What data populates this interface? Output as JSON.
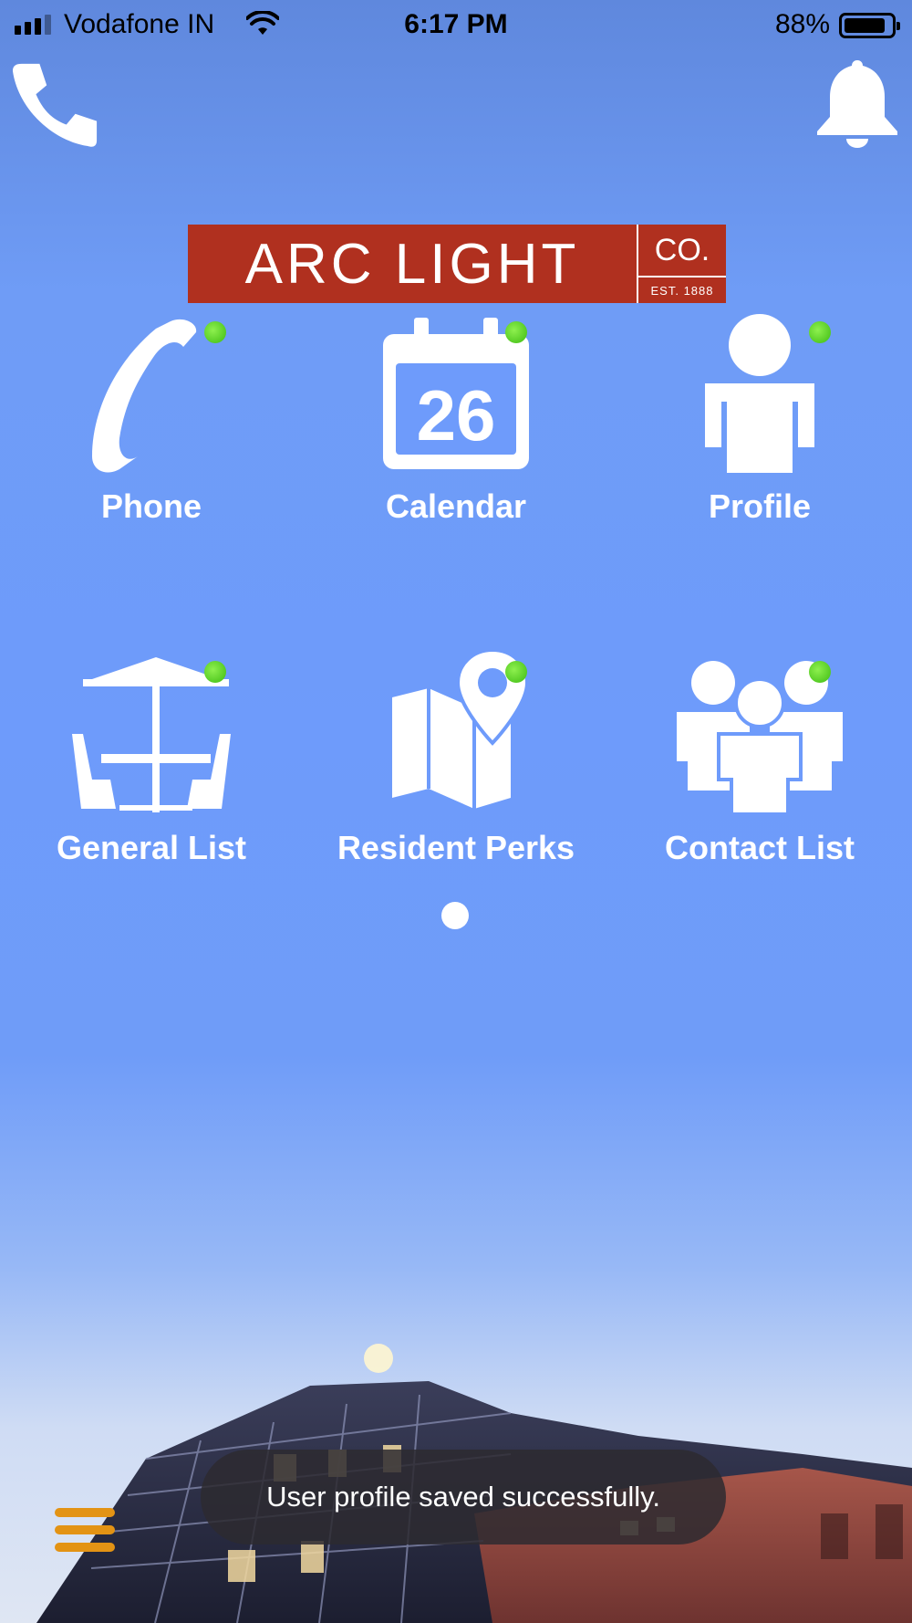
{
  "status_bar": {
    "carrier": "Vodafone IN",
    "time": "6:17 PM",
    "battery": "88%",
    "battery_level": 0.88
  },
  "header": {
    "left_icon": "phone-icon",
    "right_icon": "bell-icon"
  },
  "logo": {
    "main": "ARC LIGHT",
    "co": "CO.",
    "est": "EST. 1888"
  },
  "grid": {
    "items": [
      {
        "label": "Phone",
        "icon": "phone-icon",
        "badge_color": "#3dbb12"
      },
      {
        "label": "Calendar",
        "icon": "calendar-icon",
        "badge_color": "#3dbb12",
        "calendar_day": "26"
      },
      {
        "label": "Profile",
        "icon": "person-icon",
        "badge_color": "#3dbb12"
      },
      {
        "label": "General List",
        "icon": "patio-table-icon",
        "badge_color": "#3dbb12"
      },
      {
        "label": "Resident Perks",
        "icon": "map-pin-icon",
        "badge_color": "#3dbb12"
      },
      {
        "label": "Contact List",
        "icon": "group-icon",
        "badge_color": "#3dbb12"
      }
    ]
  },
  "pager": {
    "pages": 1,
    "current": 1
  },
  "toast": {
    "message": "User profile saved successfully."
  },
  "menu": {
    "icon": "hamburger-menu-icon",
    "color": "#e39314"
  }
}
